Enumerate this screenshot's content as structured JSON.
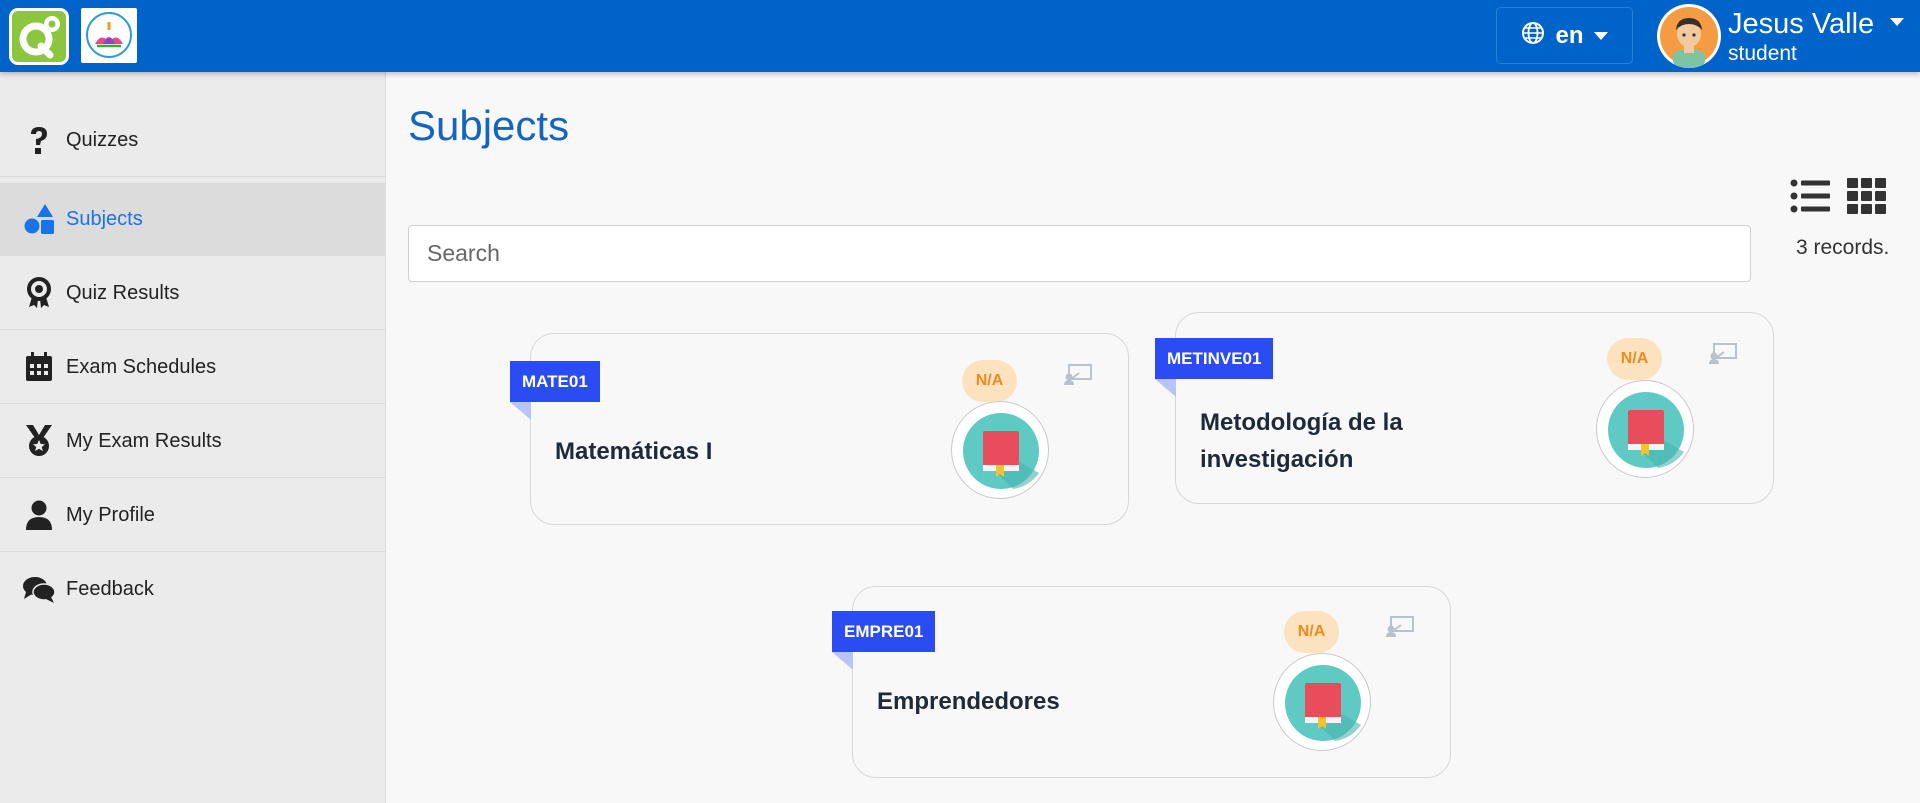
{
  "header": {
    "language": "en",
    "user_name": "Jesus Valle",
    "user_role": "student"
  },
  "sidebar": {
    "items": [
      {
        "label": "Quizzes",
        "icon": "question-icon"
      },
      {
        "label": "Subjects",
        "icon": "shapes-icon",
        "active": true
      },
      {
        "label": "Quiz Results",
        "icon": "award-icon"
      },
      {
        "label": "Exam Schedules",
        "icon": "calendar-icon"
      },
      {
        "label": "My Exam Results",
        "icon": "medal-icon"
      },
      {
        "label": "My Profile",
        "icon": "user-icon"
      },
      {
        "label": "Feedback",
        "icon": "comments-icon"
      }
    ]
  },
  "main": {
    "title": "Subjects",
    "search_placeholder": "Search",
    "records": "3 records.",
    "subjects": [
      {
        "code": "MATE01",
        "name": "Matemáticas I",
        "badge": "N/A"
      },
      {
        "code": "METINVE01",
        "name_line1": "Metodología de la",
        "name_line2": "investigación",
        "badge": "N/A"
      },
      {
        "code": "EMPRE01",
        "name": "Emprendedores",
        "badge": "N/A"
      }
    ]
  },
  "colors": {
    "topbar": "#0063c9",
    "accent": "#1565c0",
    "code_tag": "#2b4cf2",
    "badge_bg": "#fde2c0",
    "badge_text": "#f08a1e"
  }
}
